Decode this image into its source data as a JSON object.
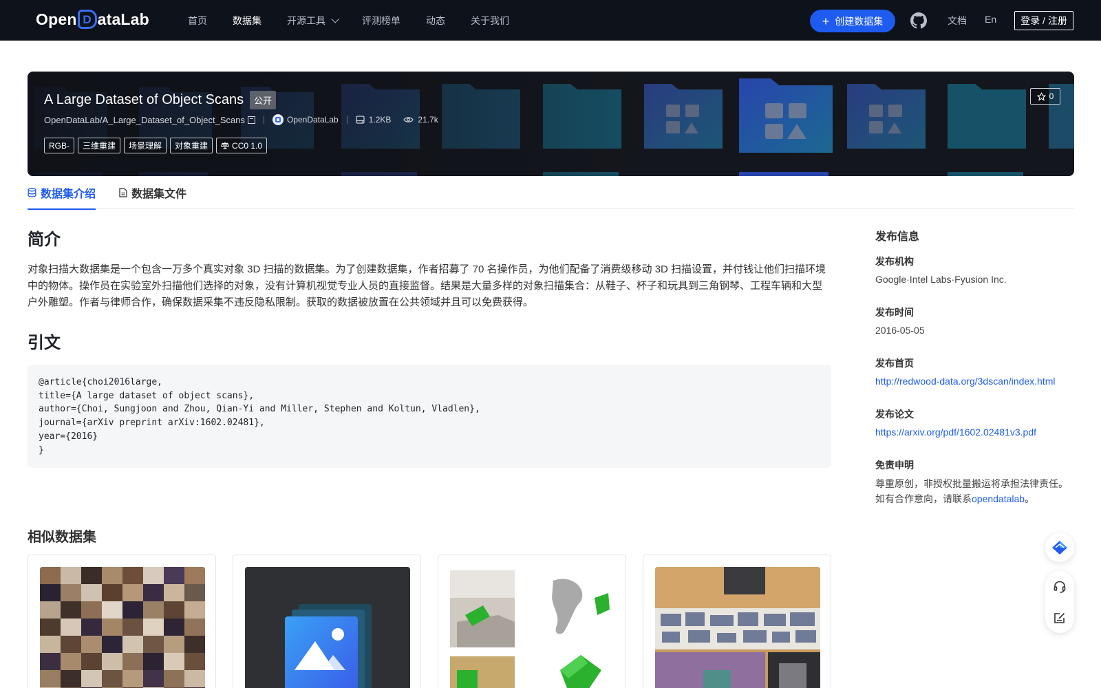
{
  "nav": {
    "logo_left": "Open",
    "logo_mark": "D",
    "logo_right": "ataLab",
    "links": [
      {
        "label": "首页",
        "active": false
      },
      {
        "label": "数据集",
        "active": true
      },
      {
        "label": "开源工具",
        "active": false,
        "dropdown": true
      },
      {
        "label": "评测榜单",
        "active": false
      },
      {
        "label": "动态",
        "active": false
      },
      {
        "label": "关于我们",
        "active": false
      }
    ],
    "create_button": "创建数据集",
    "docs": "文档",
    "lang": "En",
    "login": "登录 / 注册"
  },
  "dataset": {
    "title": "A Large Dataset of Object Scans",
    "visibility": "公开",
    "path": "OpenDataLab/A_Large_Dataset_of_Object_Scans",
    "org": "OpenDataLab",
    "size": "1.2KB",
    "views": "21.7k",
    "tags": [
      "RGB-",
      "三维重建",
      "场景理解",
      "对象重建"
    ],
    "license": "CC0 1.0",
    "stars": "0"
  },
  "tabs": [
    {
      "label": "数据集介绍",
      "active": true
    },
    {
      "label": "数据集文件",
      "active": false
    }
  ],
  "main": {
    "intro_heading": "简介",
    "intro_text": "对象扫描大数据集是一个包含一万多个真实对象 3D 扫描的数据集。为了创建数据集，作者招募了 70 名操作员，为他们配备了消费级移动 3D 扫描设置，并付钱让他们扫描环境中的物体。操作员在实验室外扫描他们选择的对象，没有计算机视觉专业人员的直接监督。结果是大量多样的对象扫描集合：从鞋子、杯子和玩具到三角钢琴、工程车辆和大型户外雕塑。作者与律师合作，确保数据采集不违反隐私限制。获取的数据被放置在公共领域并且可以免费获得。",
    "citation_heading": "引文",
    "citation": "@article{choi2016large,\ntitle={A large dataset of object scans},\nauthor={Choi, Sungjoon and Zhou, Qian-Yi and Miller, Stephen and Koltun, Vladlen},\njournal={arXiv preprint arXiv:1602.02481},\nyear={2016}\n}",
    "similar_heading": "相似数据集"
  },
  "sidebar": {
    "title": "发布信息",
    "org_label": "发布机构",
    "org_value": "Google·Intel Labs·Fyusion Inc.",
    "date_label": "发布时间",
    "date_value": "2016-05-05",
    "home_label": "发布首页",
    "home_value": "http://redwood-data.org/3dscan/index.html",
    "paper_label": "发布论文",
    "paper_value": "https://arxiv.org/pdf/1602.02481v3.pdf",
    "disclaimer_label": "免责申明",
    "disclaimer_line1": "尊重原创，非授权批量搬运将承担法律责任。",
    "disclaimer_line2_prefix": "如有合作意向，请联系",
    "disclaimer_link": "opendatalab",
    "disclaimer_suffix": "。"
  },
  "colors": {
    "accent": "#1e5cf0",
    "nav_bg": "#0e121b"
  }
}
